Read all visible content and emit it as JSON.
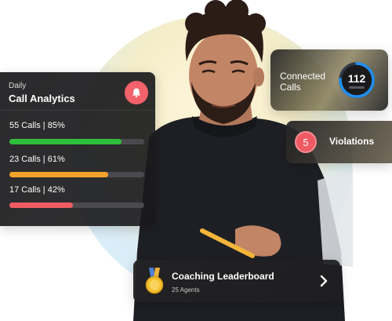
{
  "analytics": {
    "subtitle": "Daily",
    "title": "Call Analytics",
    "icon": "bell-icon",
    "metrics": [
      {
        "label": "55 Calls | 85%",
        "progress": 0.83,
        "color": "#2fbf3e"
      },
      {
        "label": "23 Calls | 61%",
        "progress": 0.73,
        "color": "#f4a12a"
      },
      {
        "label": "17 Calls | 42%",
        "progress": 0.47,
        "color": "#ef5c63"
      }
    ]
  },
  "connected": {
    "label": "Connected Calls",
    "value": "112",
    "ring_color": "#1f8ff0"
  },
  "violations": {
    "count": "5",
    "label": "Violations",
    "badge_color": "#ef5a63"
  },
  "leaderboard": {
    "title": "Coaching Leaderboard",
    "subtitle": "25 Agents",
    "icon": "medal-icon",
    "action_icon": "chevron-right-icon"
  }
}
